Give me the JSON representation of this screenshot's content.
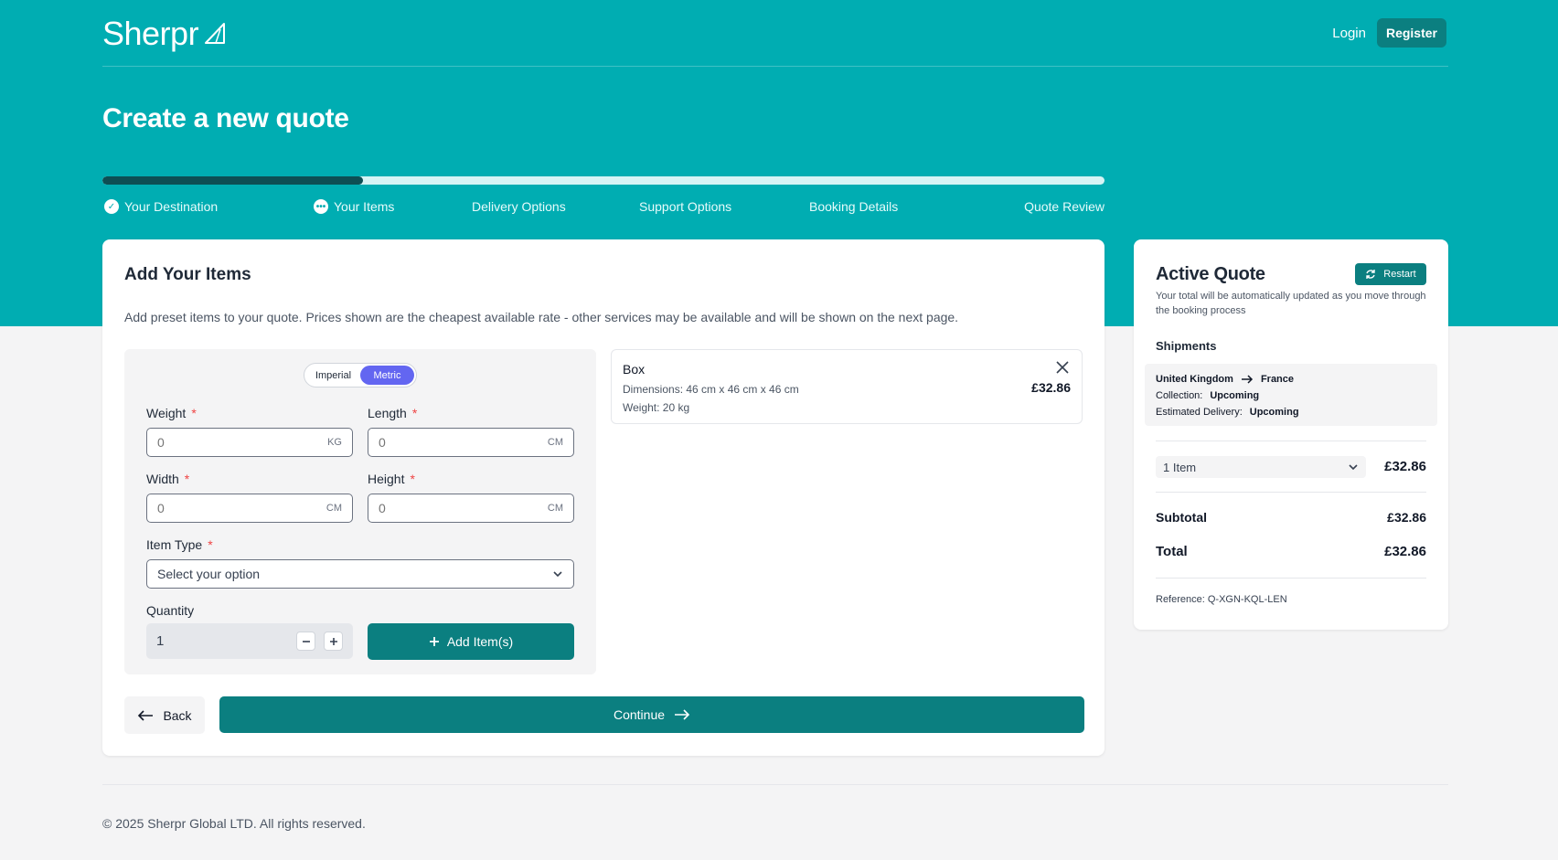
{
  "brand": {
    "name": "Sherpr",
    "accent": "#00adb2",
    "dark_accent": "#0b7f80"
  },
  "nav": {
    "login_label": "Login",
    "register_label": "Register"
  },
  "page": {
    "title": "Create a new quote"
  },
  "progress": {
    "fraction": 0.26,
    "steps": [
      {
        "label": "Your Destination",
        "status": "complete",
        "icon": "check-icon"
      },
      {
        "label": "Your Items",
        "status": "current",
        "icon": "more-dots-icon"
      },
      {
        "label": "Delivery Options",
        "status": "upcoming"
      },
      {
        "label": "Support Options",
        "status": "upcoming"
      },
      {
        "label": "Booking Details",
        "status": "upcoming"
      },
      {
        "label": "Quote Review",
        "status": "upcoming"
      }
    ]
  },
  "items_form": {
    "title": "Add Your Items",
    "description": "Add preset items to your quote. Prices shown are the cheapest available rate - other services may be available and will be shown on the next page.",
    "unit_toggle": {
      "imperial_label": "Imperial",
      "metric_label": "Metric",
      "selected": "Metric"
    },
    "weight": {
      "label": "Weight",
      "required": "*",
      "placeholder": "0",
      "unit": "KG"
    },
    "length": {
      "label": "Length",
      "required": "*",
      "placeholder": "0",
      "unit": "CM"
    },
    "width": {
      "label": "Width",
      "required": "*",
      "placeholder": "0",
      "unit": "CM"
    },
    "height": {
      "label": "Height",
      "required": "*",
      "placeholder": "0",
      "unit": "CM"
    },
    "item_type": {
      "label": "Item Type",
      "required": "*",
      "placeholder": "Select your option"
    },
    "quantity": {
      "label": "Quantity",
      "value": "1"
    },
    "add_button_label": "Add Item(s)"
  },
  "added_item": {
    "name": "Box",
    "dimensions": "Dimensions: 46 cm x 46 cm x 46 cm",
    "weight": "Weight: 20 kg",
    "price": "£32.86"
  },
  "actions": {
    "back_label": "Back",
    "continue_label": "Continue"
  },
  "quote": {
    "title": "Active Quote",
    "restart_label": "Restart",
    "description": "Your total will be automatically updated as you move through the booking process",
    "shipments_label": "Shipments",
    "origin": "United Kingdom",
    "destination": "France",
    "collection_label": "Collection:",
    "collection_value": "Upcoming",
    "delivery_label": "Estimated Delivery:",
    "delivery_value": "Upcoming",
    "items_summary": "1 Item",
    "items_price": "£32.86",
    "subtotal_label": "Subtotal",
    "subtotal_value": "£32.86",
    "total_label": "Total",
    "total_value": "£32.86",
    "reference": "Reference: Q-XGN-KQL-LEN"
  },
  "footer": {
    "copyright": "© 2025 Sherpr Global LTD. All rights reserved."
  }
}
